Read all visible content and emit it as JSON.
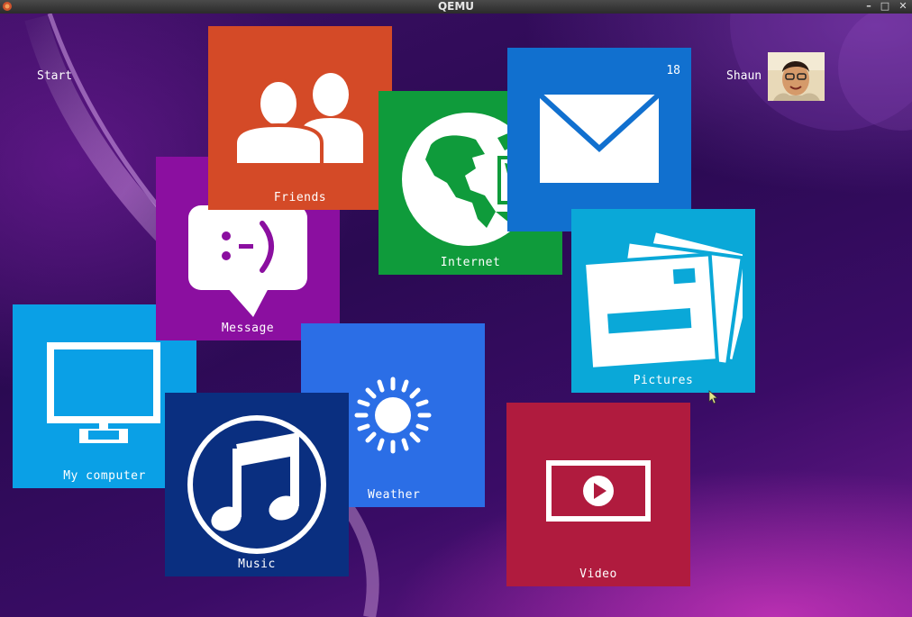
{
  "window": {
    "title": "QEMU",
    "controls": {
      "minimize": "–",
      "maximize": "□",
      "close": "✕"
    }
  },
  "desktop": {
    "start_label": "Start",
    "user": {
      "name": "Shaun"
    }
  },
  "tiles": {
    "friends": {
      "label": "Friends",
      "color": "#d44a27",
      "icon": "people-icon"
    },
    "internet": {
      "label": "Internet",
      "color": "#0f9b3b",
      "icon": "globe-icon"
    },
    "mail": {
      "label": "Mail",
      "color": "#1170cf",
      "icon": "envelope-icon",
      "badge": "18"
    },
    "message": {
      "label": "Message",
      "color": "#8b0fa0",
      "icon": "chat-bubble-icon"
    },
    "pictures": {
      "label": "Pictures",
      "color": "#0aa8d8",
      "icon": "photos-icon"
    },
    "my_computer": {
      "label": "My computer",
      "color": "#0aa0e6",
      "icon": "monitor-icon"
    },
    "weather": {
      "label": "Weather",
      "color": "#2b6ee6",
      "icon": "sun-icon"
    },
    "music": {
      "label": "Music",
      "color": "#0a2f80",
      "icon": "music-note-icon"
    },
    "video": {
      "label": "Video",
      "color": "#b01b3e",
      "icon": "play-video-icon"
    }
  }
}
